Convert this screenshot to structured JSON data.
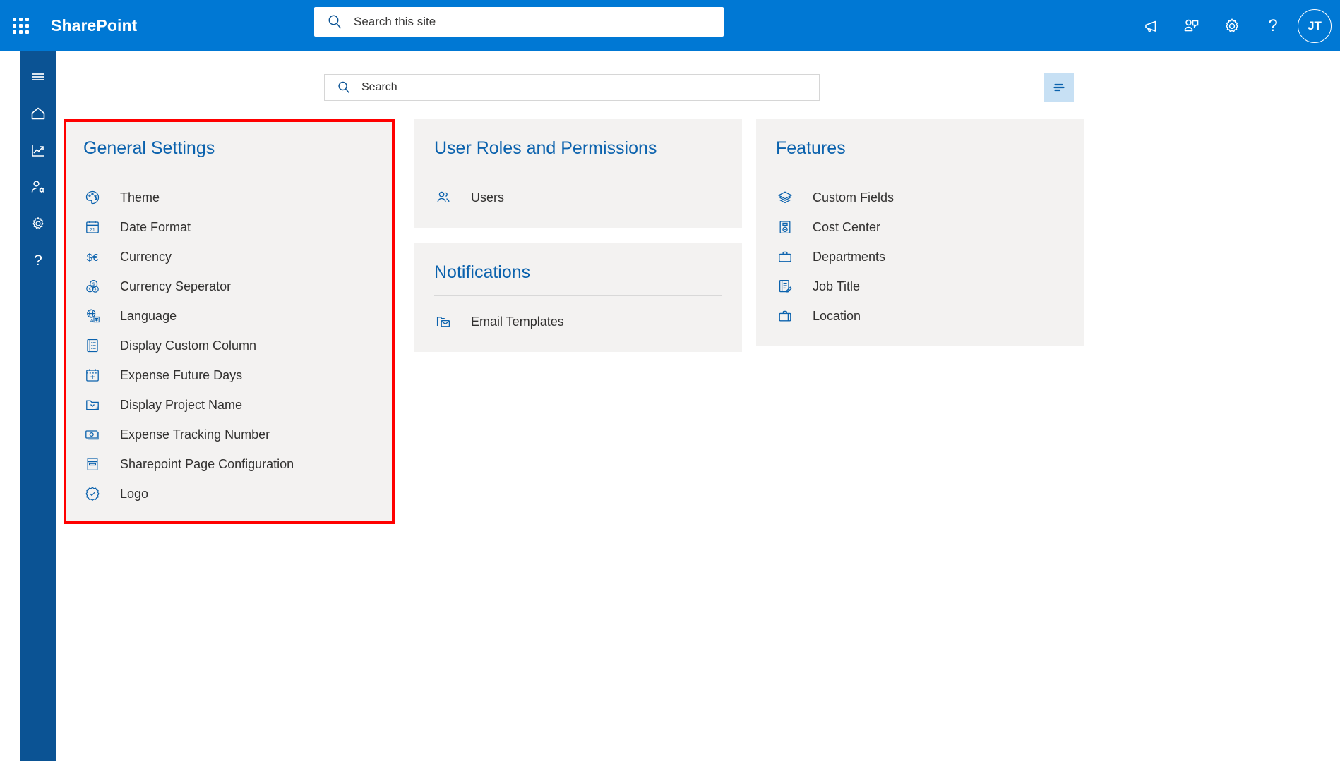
{
  "suite": {
    "waffle_icon": "app-launcher-icon",
    "title": "SharePoint",
    "search_placeholder": "Search this site",
    "search_value": "",
    "search_icon": "search-icon",
    "icons": [
      {
        "name": "megaphone-icon",
        "label": "Megaphone"
      },
      {
        "name": "people-chat-icon",
        "label": "Who is viewing"
      },
      {
        "name": "gear-icon",
        "label": "Settings"
      },
      {
        "name": "help-icon",
        "label": "Help"
      }
    ],
    "avatar_initials": "JT"
  },
  "rail": {
    "items": [
      {
        "name": "hamburger-icon",
        "label": "Menu"
      },
      {
        "name": "home-icon",
        "label": "Home"
      },
      {
        "name": "analytics-icon",
        "label": "Analytics"
      },
      {
        "name": "user-settings-icon",
        "label": "User settings"
      },
      {
        "name": "gear-icon",
        "label": "Settings"
      },
      {
        "name": "help-icon",
        "label": "Help"
      }
    ]
  },
  "toolbar": {
    "search_placeholder": "Search",
    "search_value": "",
    "search_icon": "search-icon",
    "filter_icon": "filter-lines-icon"
  },
  "colors": {
    "brand_blue": "#0078d4",
    "rail_blue": "#0b5394",
    "card_bg": "#f3f2f1",
    "card_title": "#0b62ad",
    "highlight": "#ff0000",
    "filter_button_bg": "#c7e0f4"
  },
  "cards": [
    {
      "id": "general-settings",
      "title": "General Settings",
      "highlighted": true,
      "items": [
        {
          "label": "Theme",
          "icon": "palette-icon"
        },
        {
          "label": "Date Format",
          "icon": "calendar-date-icon"
        },
        {
          "label": "Currency",
          "icon": "currency-dollar-euro-icon"
        },
        {
          "label": "Currency Seperator",
          "icon": "coins-icon"
        },
        {
          "label": "Language",
          "icon": "globe-translate-icon"
        },
        {
          "label": "Display Custom Column",
          "icon": "list-document-icon"
        },
        {
          "label": "Expense Future Days",
          "icon": "calendar-add-icon"
        },
        {
          "label": "Display Project Name",
          "icon": "folder-add-icon"
        },
        {
          "label": "Expense Tracking Number",
          "icon": "money-bill-icon"
        },
        {
          "label": "Sharepoint Page Configuration",
          "icon": "page-layout-icon"
        },
        {
          "label": "Logo",
          "icon": "badge-check-icon"
        }
      ]
    },
    {
      "id": "user-roles-and-permissions",
      "title": "User Roles and Permissions",
      "highlighted": false,
      "items": [
        {
          "label": "Users",
          "icon": "people-icon"
        }
      ]
    },
    {
      "id": "notifications",
      "title": "Notifications",
      "highlighted": false,
      "items": [
        {
          "label": "Email Templates",
          "icon": "mail-folder-icon"
        }
      ]
    },
    {
      "id": "features",
      "title": "Features",
      "highlighted": false,
      "items": [
        {
          "label": "Custom Fields",
          "icon": "layers-icon"
        },
        {
          "label": "Cost Center",
          "icon": "cost-center-icon"
        },
        {
          "label": "Departments",
          "icon": "briefcase-icon"
        },
        {
          "label": "Job Title",
          "icon": "document-edit-icon"
        },
        {
          "label": "Location",
          "icon": "suitcase-icon"
        }
      ]
    }
  ]
}
